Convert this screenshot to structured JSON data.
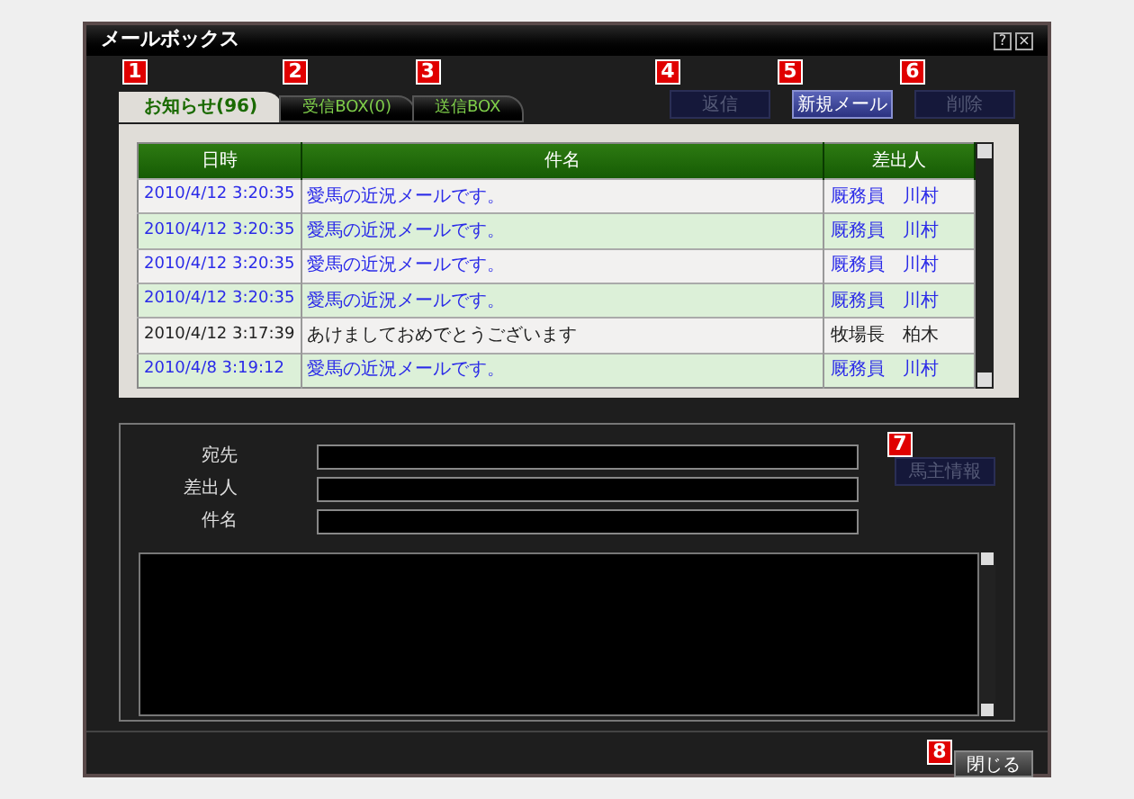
{
  "window": {
    "title": "メールボックス",
    "controls": [
      "?",
      "×"
    ]
  },
  "tabs": [
    {
      "label": "お知らせ(96)",
      "selected": true,
      "badge": "1"
    },
    {
      "label": "受信BOX(0)",
      "selected": false,
      "badge": "2"
    },
    {
      "label": "送信BOX",
      "selected": false,
      "badge": "3"
    }
  ],
  "actions": [
    {
      "label": "返信",
      "disabled": true,
      "badge": "4"
    },
    {
      "label": "新規メール",
      "disabled": false,
      "badge": "5"
    },
    {
      "label": "削除",
      "disabled": true,
      "badge": "6"
    }
  ],
  "table": {
    "columns": [
      "日時",
      "件名",
      "差出人"
    ],
    "rows": [
      {
        "cells": [
          "2010/4/12 3:20:35",
          "愛馬の近況メールです。",
          "厩務員　川村"
        ],
        "linked": true
      },
      {
        "cells": [
          "2010/4/12 3:20:35",
          "愛馬の近況メールです。",
          "厩務員　川村"
        ],
        "linked": true
      },
      {
        "cells": [
          "2010/4/12 3:20:35",
          "愛馬の近況メールです。",
          "厩務員　川村"
        ],
        "linked": true
      },
      {
        "cells": [
          "2010/4/12 3:20:35",
          "愛馬の近況メールです。",
          "厩務員　川村"
        ],
        "linked": true
      },
      {
        "cells": [
          "2010/4/12 3:17:39",
          "あけましておめでとうございます",
          "牧場長　柏木"
        ],
        "linked": false
      },
      {
        "cells": [
          "2010/4/8 3:19:12",
          "愛馬の近況メールです。",
          "厩務員　川村"
        ],
        "linked": true
      }
    ]
  },
  "detail": {
    "fields": [
      "宛先",
      "差出人",
      "件名"
    ],
    "owner_button": {
      "label": "馬主情報",
      "disabled": true,
      "badge": "7"
    }
  },
  "close_button": {
    "label": "閉じる",
    "disabled": false,
    "badge": "8"
  }
}
